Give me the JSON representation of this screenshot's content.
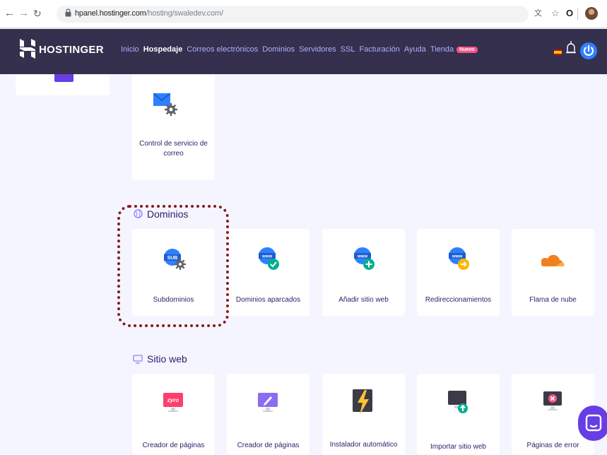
{
  "browser": {
    "url_host": "hpanel.hostinger.com",
    "url_path": "/hosting/swaledev.com/",
    "back_icon": "back-arrow-icon",
    "forward_icon": "forward-arrow-icon",
    "reload_icon": "reload-icon"
  },
  "header": {
    "logo_text": "HOSTINGER",
    "nav": [
      {
        "label": "Inicio"
      },
      {
        "label": "Hospedaje"
      },
      {
        "label": "Correos electrónicos"
      },
      {
        "label": "Dominios"
      },
      {
        "label": "Servidores"
      },
      {
        "label": "SSL"
      },
      {
        "label": "Facturación"
      },
      {
        "label": "Ayuda"
      },
      {
        "label": "Tienda"
      }
    ],
    "badge_new": "Nuevo",
    "colors": {
      "header_bg": "#34304d",
      "nav_text": "#aeb0ff",
      "accent": "#673de6"
    }
  },
  "email_section": {
    "card_label": "Control de servicio de correo"
  },
  "domains_section": {
    "title": "Dominios",
    "cards": [
      {
        "label": "Subdominios",
        "icon": "subdomain-globe-icon"
      },
      {
        "label": "Dominios aparcados",
        "icon": "parked-domain-globe-icon"
      },
      {
        "label": "Añadir sitio web",
        "icon": "add-website-globe-icon"
      },
      {
        "label": "Redireccionamientos",
        "icon": "redirect-globe-icon"
      },
      {
        "label": "Flama de nube",
        "icon": "cloudflare-icon"
      }
    ]
  },
  "website_section": {
    "title": "Sitio web",
    "cards": [
      {
        "label": "Creador de páginas",
        "icon": "zyro-builder-icon",
        "icon_text": "zyro"
      },
      {
        "label": "Creador de páginas",
        "icon": "page-builder-pen-icon"
      },
      {
        "label": "Instalador automático",
        "icon": "auto-installer-bolt-icon"
      },
      {
        "label": "Importar sitio web",
        "icon": "import-website-icon"
      },
      {
        "label": "Páginas de error",
        "icon": "error-pages-icon"
      }
    ]
  }
}
